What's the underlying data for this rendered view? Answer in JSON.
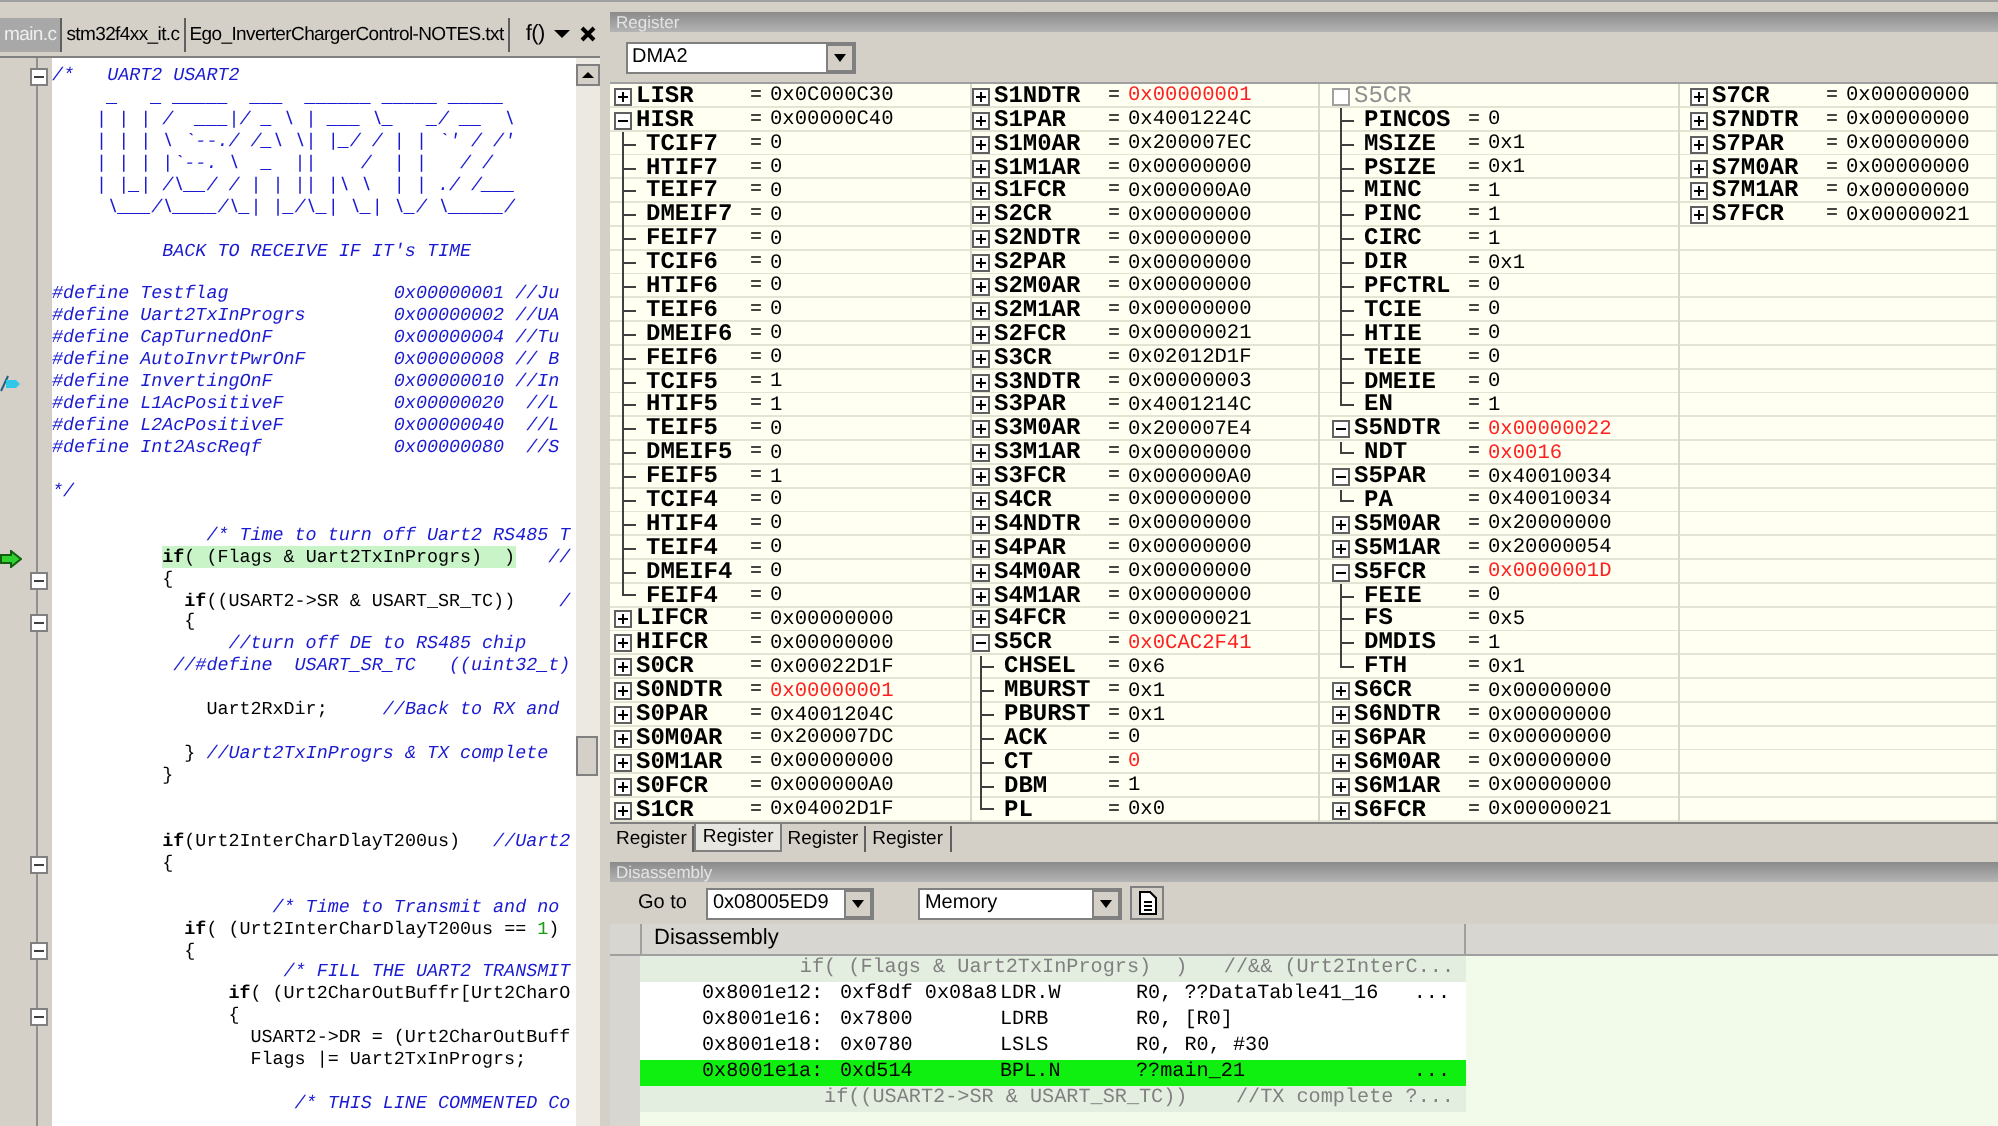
{
  "editor": {
    "tabs": [
      {
        "label": "main.c",
        "selected": true
      },
      {
        "label": "stm32f4xx_it.c",
        "selected": false
      },
      {
        "label": "Ego_InverterChargerControl-NOTES.txt",
        "selected": false
      }
    ],
    "function_button": "f()",
    "lines": [
      {
        "kind": "comment",
        "text": "/*   UART2 USART2",
        "fold": true,
        "current": false,
        "bookmark": false
      },
      {
        "kind": "comment",
        "text": "     _   _ _____  ___  ______ _____ _____",
        "fold": false,
        "current": false,
        "bookmark": false
      },
      {
        "kind": "comment",
        "text": "    | | | /  ___|/ _ \\ | ___ \\_   _/ __  \\",
        "fold": false,
        "current": false,
        "bookmark": false
      },
      {
        "kind": "comment",
        "text": "    | | | \\ `--./ /_\\ \\| |_/ / | | `' / /'",
        "fold": false,
        "current": false,
        "bookmark": false
      },
      {
        "kind": "comment",
        "text": "    | | | |`--. \\  _  ||    /  | |   / /",
        "fold": false,
        "current": false,
        "bookmark": false
      },
      {
        "kind": "comment",
        "text": "    | |_| /\\__/ / | | || |\\ \\  | | ./ /___",
        "fold": false,
        "current": false,
        "bookmark": false
      },
      {
        "kind": "comment",
        "text": "     \\___/\\____/\\_| |_/\\_| \\_| \\_/ \\_____/",
        "fold": false,
        "current": false,
        "bookmark": false
      },
      {
        "kind": "blank",
        "fold": false,
        "current": false,
        "bookmark": false
      },
      {
        "kind": "comment",
        "text": "          BACK TO RECEIVE IF IT's TIME",
        "fold": false,
        "current": false,
        "bookmark": false
      },
      {
        "kind": "blank",
        "fold": false,
        "current": false,
        "bookmark": false
      },
      {
        "kind": "comment",
        "text": "#define Testflag               0x00000001 //Ju",
        "fold": false,
        "current": false,
        "bookmark": false
      },
      {
        "kind": "comment",
        "text": "#define Uart2TxInProgrs        0x00000002 //UA",
        "fold": false,
        "current": false,
        "bookmark": false
      },
      {
        "kind": "comment",
        "text": "#define CapTurnedOnF           0x00000004 //Tu",
        "fold": false,
        "current": false,
        "bookmark": false
      },
      {
        "kind": "comment",
        "text": "#define AutoInvrtPwrOnF        0x00000008 // B",
        "fold": false,
        "current": false,
        "bookmark": false
      },
      {
        "kind": "comment",
        "text": "#define InvertingOnF           0x00000010 //In",
        "fold": false,
        "current": false,
        "bookmark": true
      },
      {
        "kind": "comment",
        "text": "#define L1AcPositiveF          0x00000020  //L",
        "fold": false,
        "current": false,
        "bookmark": false
      },
      {
        "kind": "comment",
        "text": "#define L2AcPositiveF          0x00000040  //L",
        "fold": false,
        "current": false,
        "bookmark": false
      },
      {
        "kind": "comment",
        "text": "#define Int2AscReqf            0x00000080  //S",
        "fold": false,
        "current": false,
        "bookmark": false
      },
      {
        "kind": "blank",
        "fold": false,
        "current": false,
        "bookmark": false
      },
      {
        "kind": "comment",
        "text": "*/",
        "fold": false,
        "current": false,
        "bookmark": false
      },
      {
        "kind": "blank",
        "fold": false,
        "current": false,
        "bookmark": false
      },
      {
        "kind": "comment",
        "text": "              /* Time to turn off Uart2 RS485 T",
        "fold": false,
        "current": false,
        "bookmark": false
      },
      {
        "kind": "code",
        "text": "          if( (Flags & Uart2TxInProgrs)  )",
        "comment": "   //",
        "fold": false,
        "current": true,
        "bookmark": false
      },
      {
        "kind": "code",
        "text": "          {",
        "fold": true,
        "current": false,
        "bookmark": false
      },
      {
        "kind": "code",
        "text": "            if((USART2->SR & USART_SR_TC))",
        "comment": "    /",
        "fold": false,
        "current": false,
        "bookmark": false
      },
      {
        "kind": "code",
        "text": "            {",
        "fold": true,
        "current": false,
        "bookmark": false
      },
      {
        "kind": "comment",
        "text": "                //turn off DE to RS485 chip",
        "fold": false,
        "current": false,
        "bookmark": false
      },
      {
        "kind": "comment",
        "text": "           //#define  USART_SR_TC   ((uint32_t)",
        "fold": false,
        "current": false,
        "bookmark": false
      },
      {
        "kind": "blank",
        "fold": false,
        "current": false,
        "bookmark": false
      },
      {
        "kind": "code",
        "text": "              Uart2RxDir;",
        "comment": "     //Back to RX and",
        "fold": false,
        "current": false,
        "bookmark": false
      },
      {
        "kind": "blank",
        "fold": false,
        "current": false,
        "bookmark": false
      },
      {
        "kind": "code",
        "text": "            }",
        "comment": " //Uart2TxInProgrs & TX complete",
        "fold": false,
        "current": false,
        "bookmark": false
      },
      {
        "kind": "code",
        "text": "          }",
        "fold": false,
        "current": false,
        "bookmark": false
      },
      {
        "kind": "blank",
        "fold": false,
        "current": false,
        "bookmark": false
      },
      {
        "kind": "blank",
        "fold": false,
        "current": false,
        "bookmark": false
      },
      {
        "kind": "code",
        "text": "          if(Urt2InterCharDlayT200us)",
        "comment": "   //Uart2",
        "fold": false,
        "current": false,
        "bookmark": false
      },
      {
        "kind": "code",
        "text": "          {",
        "fold": true,
        "current": false,
        "bookmark": false
      },
      {
        "kind": "blank",
        "fold": false,
        "current": false,
        "bookmark": false
      },
      {
        "kind": "comment",
        "text": "                    /* Time to Transmit and no",
        "fold": false,
        "current": false,
        "bookmark": false
      },
      {
        "kind": "code",
        "text": "            if( (Urt2InterCharDlayT200us == 1)",
        "fold": false,
        "current": false,
        "bookmark": false
      },
      {
        "kind": "code",
        "text": "            {",
        "fold": true,
        "current": false,
        "bookmark": false
      },
      {
        "kind": "comment",
        "text": "                     /* FILL THE UART2 TRANSMIT",
        "fold": false,
        "current": false,
        "bookmark": false
      },
      {
        "kind": "code",
        "text": "                if( (Urt2CharOutBuffr[Urt2CharO",
        "fold": false,
        "current": false,
        "bookmark": false
      },
      {
        "kind": "code",
        "text": "                {",
        "fold": true,
        "current": false,
        "bookmark": false
      },
      {
        "kind": "code",
        "text": "                  USART2->DR = (Urt2CharOutBuff",
        "fold": false,
        "current": false,
        "bookmark": false
      },
      {
        "kind": "code",
        "text": "                  Flags |= Uart2TxInProgrs;",
        "fold": false,
        "current": false,
        "bookmark": false
      },
      {
        "kind": "blank",
        "fold": false,
        "current": false,
        "bookmark": false
      },
      {
        "kind": "comment",
        "text": "                      /* THIS LINE COMMENTED Co",
        "fold": false,
        "current": false,
        "bookmark": false
      }
    ]
  },
  "registers": {
    "title": "Register",
    "device": "DMA2",
    "columns": [
      {
        "items": [
          {
            "kind": "register",
            "name": "LISR",
            "eq": "=",
            "value": "0x0C000C30",
            "changed": false,
            "expanded": false
          },
          {
            "kind": "register",
            "name": "HISR",
            "eq": "=",
            "value": "0x00000C40",
            "changed": false,
            "expanded": true,
            "children": [
              {
                "name": "TCIF7",
                "eq": "=",
                "value": "0",
                "changed": false
              },
              {
                "name": "HTIF7",
                "eq": "=",
                "value": "0",
                "changed": false
              },
              {
                "name": "TEIF7",
                "eq": "=",
                "value": "0",
                "changed": false
              },
              {
                "name": "DMEIF7",
                "eq": "=",
                "value": "0",
                "changed": false
              },
              {
                "name": "FEIF7",
                "eq": "=",
                "value": "0",
                "changed": false
              },
              {
                "name": "TCIF6",
                "eq": "=",
                "value": "0",
                "changed": false
              },
              {
                "name": "HTIF6",
                "eq": "=",
                "value": "0",
                "changed": false
              },
              {
                "name": "TEIF6",
                "eq": "=",
                "value": "0",
                "changed": false
              },
              {
                "name": "DMEIF6",
                "eq": "=",
                "value": "0",
                "changed": false
              },
              {
                "name": "FEIF6",
                "eq": "=",
                "value": "0",
                "changed": false
              },
              {
                "name": "TCIF5",
                "eq": "=",
                "value": "1",
                "changed": false
              },
              {
                "name": "HTIF5",
                "eq": "=",
                "value": "1",
                "changed": false
              },
              {
                "name": "TEIF5",
                "eq": "=",
                "value": "0",
                "changed": false
              },
              {
                "name": "DMEIF5",
                "eq": "=",
                "value": "0",
                "changed": false
              },
              {
                "name": "FEIF5",
                "eq": "=",
                "value": "1",
                "changed": false
              },
              {
                "name": "TCIF4",
                "eq": "=",
                "value": "0",
                "changed": false
              },
              {
                "name": "HTIF4",
                "eq": "=",
                "value": "0",
                "changed": false
              },
              {
                "name": "TEIF4",
                "eq": "=",
                "value": "0",
                "changed": false
              },
              {
                "name": "DMEIF4",
                "eq": "=",
                "value": "0",
                "changed": false
              },
              {
                "name": "FEIF4",
                "eq": "=",
                "value": "0",
                "changed": false
              }
            ]
          },
          {
            "kind": "register",
            "name": "LIFCR",
            "eq": "=",
            "value": "0x00000000",
            "changed": false,
            "expanded": false
          },
          {
            "kind": "register",
            "name": "HIFCR",
            "eq": "=",
            "value": "0x00000000",
            "changed": false,
            "expanded": false
          },
          {
            "kind": "register",
            "name": "S0CR",
            "eq": "=",
            "value": "0x00022D1F",
            "changed": false,
            "expanded": false
          },
          {
            "kind": "register",
            "name": "S0NDTR",
            "eq": "=",
            "value": "0x00000001",
            "changed": true,
            "expanded": false
          },
          {
            "kind": "register",
            "name": "S0PAR",
            "eq": "=",
            "value": "0x4001204C",
            "changed": false,
            "expanded": false
          },
          {
            "kind": "register",
            "name": "S0M0AR",
            "eq": "=",
            "value": "0x200007DC",
            "changed": false,
            "expanded": false
          },
          {
            "kind": "register",
            "name": "S0M1AR",
            "eq": "=",
            "value": "0x00000000",
            "changed": false,
            "expanded": false
          },
          {
            "kind": "register",
            "name": "S0FCR",
            "eq": "=",
            "value": "0x000000A0",
            "changed": false,
            "expanded": false
          },
          {
            "kind": "register",
            "name": "S1CR",
            "eq": "=",
            "value": "0x04002D1F",
            "changed": false,
            "expanded": false
          }
        ]
      },
      {
        "items": [
          {
            "kind": "register",
            "name": "S1NDTR",
            "eq": "=",
            "value": "0x00000001",
            "changed": true,
            "expanded": false
          },
          {
            "kind": "register",
            "name": "S1PAR",
            "eq": "=",
            "value": "0x4001224C",
            "changed": false,
            "expanded": false
          },
          {
            "kind": "register",
            "name": "S1M0AR",
            "eq": "=",
            "value": "0x200007EC",
            "changed": false,
            "expanded": false
          },
          {
            "kind": "register",
            "name": "S1M1AR",
            "eq": "=",
            "value": "0x00000000",
            "changed": false,
            "expanded": false
          },
          {
            "kind": "register",
            "name": "S1FCR",
            "eq": "=",
            "value": "0x000000A0",
            "changed": false,
            "expanded": false
          },
          {
            "kind": "register",
            "name": "S2CR",
            "eq": "=",
            "value": "0x00000000",
            "changed": false,
            "expanded": false
          },
          {
            "kind": "register",
            "name": "S2NDTR",
            "eq": "=",
            "value": "0x00000000",
            "changed": false,
            "expanded": false
          },
          {
            "kind": "register",
            "name": "S2PAR",
            "eq": "=",
            "value": "0x00000000",
            "changed": false,
            "expanded": false
          },
          {
            "kind": "register",
            "name": "S2M0AR",
            "eq": "=",
            "value": "0x00000000",
            "changed": false,
            "expanded": false
          },
          {
            "kind": "register",
            "name": "S2M1AR",
            "eq": "=",
            "value": "0x00000000",
            "changed": false,
            "expanded": false
          },
          {
            "kind": "register",
            "name": "S2FCR",
            "eq": "=",
            "value": "0x00000021",
            "changed": false,
            "expanded": false
          },
          {
            "kind": "register",
            "name": "S3CR",
            "eq": "=",
            "value": "0x02012D1F",
            "changed": false,
            "expanded": false
          },
          {
            "kind": "register",
            "name": "S3NDTR",
            "eq": "=",
            "value": "0x00000003",
            "changed": false,
            "expanded": false
          },
          {
            "kind": "register",
            "name": "S3PAR",
            "eq": "=",
            "value": "0x4001214C",
            "changed": false,
            "expanded": false
          },
          {
            "kind": "register",
            "name": "S3M0AR",
            "eq": "=",
            "value": "0x200007E4",
            "changed": false,
            "expanded": false
          },
          {
            "kind": "register",
            "name": "S3M1AR",
            "eq": "=",
            "value": "0x00000000",
            "changed": false,
            "expanded": false
          },
          {
            "kind": "register",
            "name": "S3FCR",
            "eq": "=",
            "value": "0x000000A0",
            "changed": false,
            "expanded": false
          },
          {
            "kind": "register",
            "name": "S4CR",
            "eq": "=",
            "value": "0x00000000",
            "changed": false,
            "expanded": false
          },
          {
            "kind": "register",
            "name": "S4NDTR",
            "eq": "=",
            "value": "0x00000000",
            "changed": false,
            "expanded": false
          },
          {
            "kind": "register",
            "name": "S4PAR",
            "eq": "=",
            "value": "0x00000000",
            "changed": false,
            "expanded": false
          },
          {
            "kind": "register",
            "name": "S4M0AR",
            "eq": "=",
            "value": "0x00000000",
            "changed": false,
            "expanded": false
          },
          {
            "kind": "register",
            "name": "S4M1AR",
            "eq": "=",
            "value": "0x00000000",
            "changed": false,
            "expanded": false
          },
          {
            "kind": "register",
            "name": "S4FCR",
            "eq": "=",
            "value": "0x00000021",
            "changed": false,
            "expanded": false
          },
          {
            "kind": "register",
            "name": "S5CR",
            "eq": "=",
            "value": "0x0CAC2F41",
            "changed": true,
            "expanded": true,
            "children": [
              {
                "name": "CHSEL",
                "eq": "=",
                "value": "0x6",
                "changed": false
              },
              {
                "name": "MBURST",
                "eq": "=",
                "value": "0x1",
                "changed": false
              },
              {
                "name": "PBURST",
                "eq": "=",
                "value": "0x1",
                "changed": false
              },
              {
                "name": "ACK",
                "eq": "=",
                "value": "0",
                "changed": false
              },
              {
                "name": "CT",
                "eq": "=",
                "value": "0",
                "changed": true
              },
              {
                "name": "DBM",
                "eq": "=",
                "value": "1",
                "changed": false
              },
              {
                "name": "PL",
                "eq": "=",
                "value": "0x0",
                "changed": false
              }
            ]
          }
        ]
      },
      {
        "items": [
          {
            "kind": "continued",
            "name": "S5CR",
            "children": [
              {
                "name": "PINCOS",
                "eq": "=",
                "value": "0",
                "changed": false
              },
              {
                "name": "MSIZE",
                "eq": "=",
                "value": "0x1",
                "changed": false
              },
              {
                "name": "PSIZE",
                "eq": "=",
                "value": "0x1",
                "changed": false
              },
              {
                "name": "MINC",
                "eq": "=",
                "value": "1",
                "changed": false
              },
              {
                "name": "PINC",
                "eq": "=",
                "value": "1",
                "changed": false
              },
              {
                "name": "CIRC",
                "eq": "=",
                "value": "1",
                "changed": false
              },
              {
                "name": "DIR",
                "eq": "=",
                "value": "0x1",
                "changed": false
              },
              {
                "name": "PFCTRL",
                "eq": "=",
                "value": "0",
                "changed": false
              },
              {
                "name": "TCIE",
                "eq": "=",
                "value": "0",
                "changed": false
              },
              {
                "name": "HTIE",
                "eq": "=",
                "value": "0",
                "changed": false
              },
              {
                "name": "TEIE",
                "eq": "=",
                "value": "0",
                "changed": false
              },
              {
                "name": "DMEIE",
                "eq": "=",
                "value": "0",
                "changed": false
              },
              {
                "name": "EN",
                "eq": "=",
                "value": "1",
                "changed": false
              }
            ]
          },
          {
            "kind": "register",
            "name": "S5NDTR",
            "eq": "=",
            "value": "0x00000022",
            "changed": true,
            "expanded": true,
            "children": [
              {
                "name": "NDT",
                "eq": "=",
                "value": "0x0016",
                "changed": true
              }
            ]
          },
          {
            "kind": "register",
            "name": "S5PAR",
            "eq": "=",
            "value": "0x40010034",
            "changed": false,
            "expanded": true,
            "children": [
              {
                "name": "PA",
                "eq": "=",
                "value": "0x40010034",
                "changed": false
              }
            ]
          },
          {
            "kind": "register",
            "name": "S5M0AR",
            "eq": "=",
            "value": "0x20000000",
            "changed": false,
            "expanded": false
          },
          {
            "kind": "register",
            "name": "S5M1AR",
            "eq": "=",
            "value": "0x20000054",
            "changed": false,
            "expanded": false
          },
          {
            "kind": "register",
            "name": "S5FCR",
            "eq": "=",
            "value": "0x0000001D",
            "changed": true,
            "expanded": true,
            "children": [
              {
                "name": "FEIE",
                "eq": "=",
                "value": "0",
                "changed": false
              },
              {
                "name": "FS",
                "eq": "=",
                "value": "0x5",
                "changed": false
              },
              {
                "name": "DMDIS",
                "eq": "=",
                "value": "1",
                "changed": false
              },
              {
                "name": "FTH",
                "eq": "=",
                "value": "0x1",
                "changed": false
              }
            ]
          },
          {
            "kind": "register",
            "name": "S6CR",
            "eq": "=",
            "value": "0x00000000",
            "changed": false,
            "expanded": false
          },
          {
            "kind": "register",
            "name": "S6NDTR",
            "eq": "=",
            "value": "0x00000000",
            "changed": false,
            "expanded": false
          },
          {
            "kind": "register",
            "name": "S6PAR",
            "eq": "=",
            "value": "0x00000000",
            "changed": false,
            "expanded": false
          },
          {
            "kind": "register",
            "name": "S6M0AR",
            "eq": "=",
            "value": "0x00000000",
            "changed": false,
            "expanded": false
          },
          {
            "kind": "register",
            "name": "S6M1AR",
            "eq": "=",
            "value": "0x00000000",
            "changed": false,
            "expanded": false
          },
          {
            "kind": "register",
            "name": "S6FCR",
            "eq": "=",
            "value": "0x00000021",
            "changed": false,
            "expanded": false
          }
        ]
      },
      {
        "items": [
          {
            "kind": "register",
            "name": "S7CR",
            "eq": "=",
            "value": "0x00000000",
            "changed": false,
            "expanded": false
          },
          {
            "kind": "register",
            "name": "S7NDTR",
            "eq": "=",
            "value": "0x00000000",
            "changed": false,
            "expanded": false
          },
          {
            "kind": "register",
            "name": "S7PAR",
            "eq": "=",
            "value": "0x00000000",
            "changed": false,
            "expanded": false
          },
          {
            "kind": "register",
            "name": "S7M0AR",
            "eq": "=",
            "value": "0x00000000",
            "changed": false,
            "expanded": false
          },
          {
            "kind": "register",
            "name": "S7M1AR",
            "eq": "=",
            "value": "0x00000000",
            "changed": false,
            "expanded": false
          },
          {
            "kind": "register",
            "name": "S7FCR",
            "eq": "=",
            "value": "0x00000021",
            "changed": false,
            "expanded": false
          }
        ]
      }
    ],
    "tabs": [
      {
        "label": "Register",
        "selected": false
      },
      {
        "label": "Register",
        "selected": true
      },
      {
        "label": "Register",
        "selected": false
      },
      {
        "label": "Register",
        "selected": false
      }
    ]
  },
  "disassembly": {
    "title": "Disassembly",
    "goto_label": "Go to",
    "address": "0x08005ED9",
    "view": "Memory",
    "column": "Disassembly",
    "rows": [
      {
        "kind": "source",
        "text": "if( (Flags & Uart2TxInProgrs)  )   //&& (Urt2InterC...",
        "current": false
      },
      {
        "kind": "instruction",
        "address": "0x8001e12:",
        "opcode": "0xf8df 0x08a8",
        "mnemonic": "LDR.W",
        "operands": "R0, ??DataTable41_16",
        "more": "...",
        "current": false
      },
      {
        "kind": "instruction",
        "address": "0x8001e16:",
        "opcode": "0x7800",
        "mnemonic": "LDRB",
        "operands": "R0, [R0]",
        "current": false
      },
      {
        "kind": "instruction",
        "address": "0x8001e18:",
        "opcode": "0x0780",
        "mnemonic": "LSLS",
        "operands": "R0, R0, #30",
        "current": false
      },
      {
        "kind": "instruction",
        "address": "0x8001e1a:",
        "opcode": "0xd514",
        "mnemonic": "BPL.N",
        "operands": "??main_21",
        "more": "...",
        "current": true
      },
      {
        "kind": "source",
        "text": "if((USART2->SR & USART_SR_TC))    //TX complete ?...",
        "current": false
      }
    ]
  }
}
